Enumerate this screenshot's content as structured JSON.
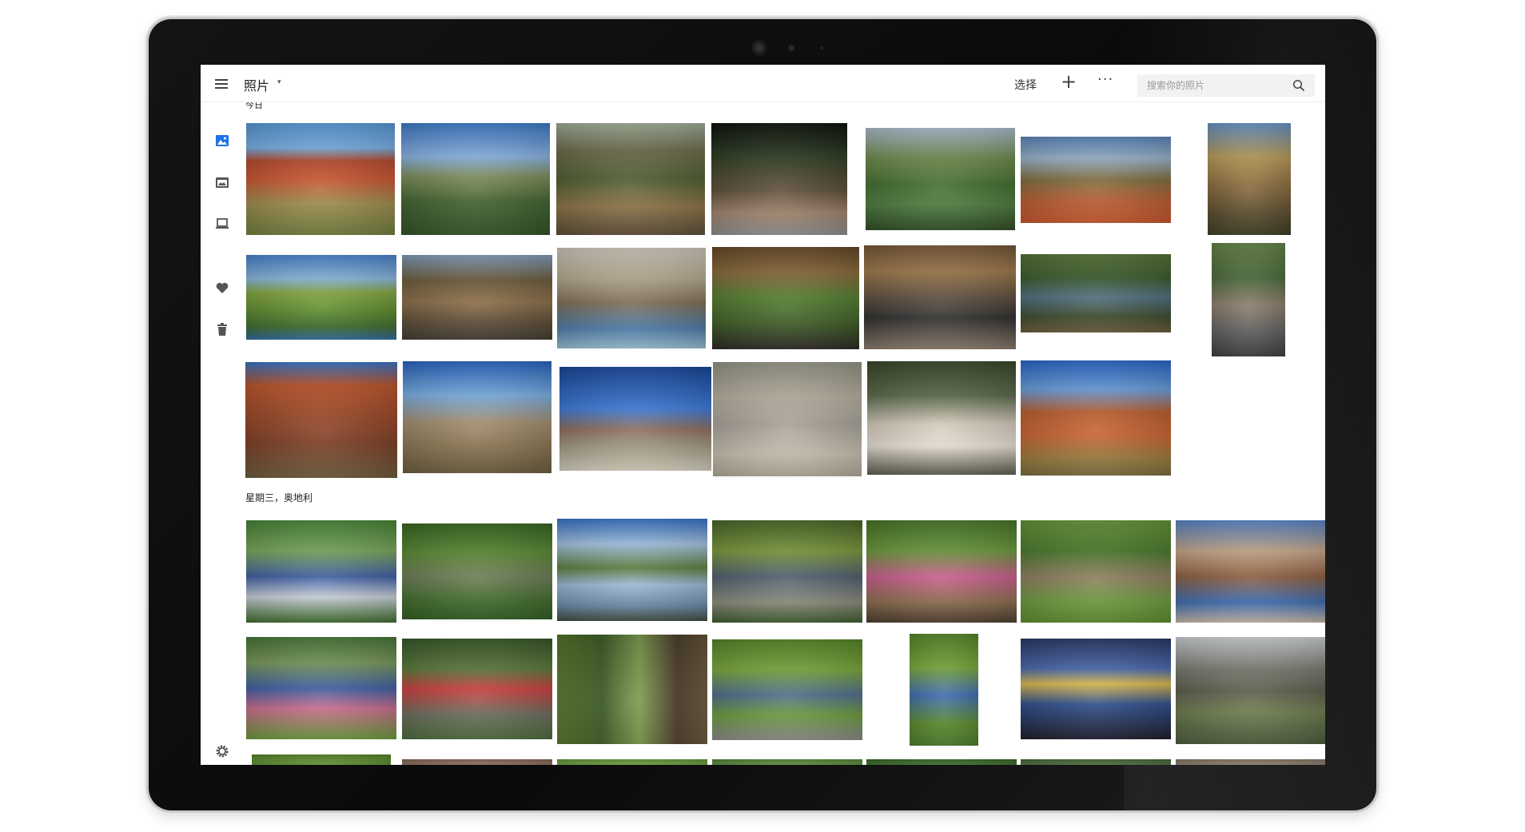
{
  "app": {
    "title": "照片",
    "title_caret": "▾"
  },
  "toolbar": {
    "select_label": "选择",
    "add_label": "+",
    "more_label": "···",
    "search_placeholder": "搜索你的照片"
  },
  "sidebar": {
    "items": [
      {
        "name": "photos-icon",
        "active": true
      },
      {
        "name": "albums-icon",
        "active": false
      },
      {
        "name": "device-icon",
        "active": false
      },
      {
        "name": "favorites-icon",
        "active": false
      },
      {
        "name": "trash-icon",
        "active": false
      }
    ],
    "settings": "gear-icon"
  },
  "sections": [
    {
      "label": "今日"
    },
    {
      "label": "星期三，奥地利"
    }
  ],
  "colors": {
    "accent": "#1a73e8",
    "frame": "#0f0f0f",
    "search_bg": "#f2f2f2"
  }
}
